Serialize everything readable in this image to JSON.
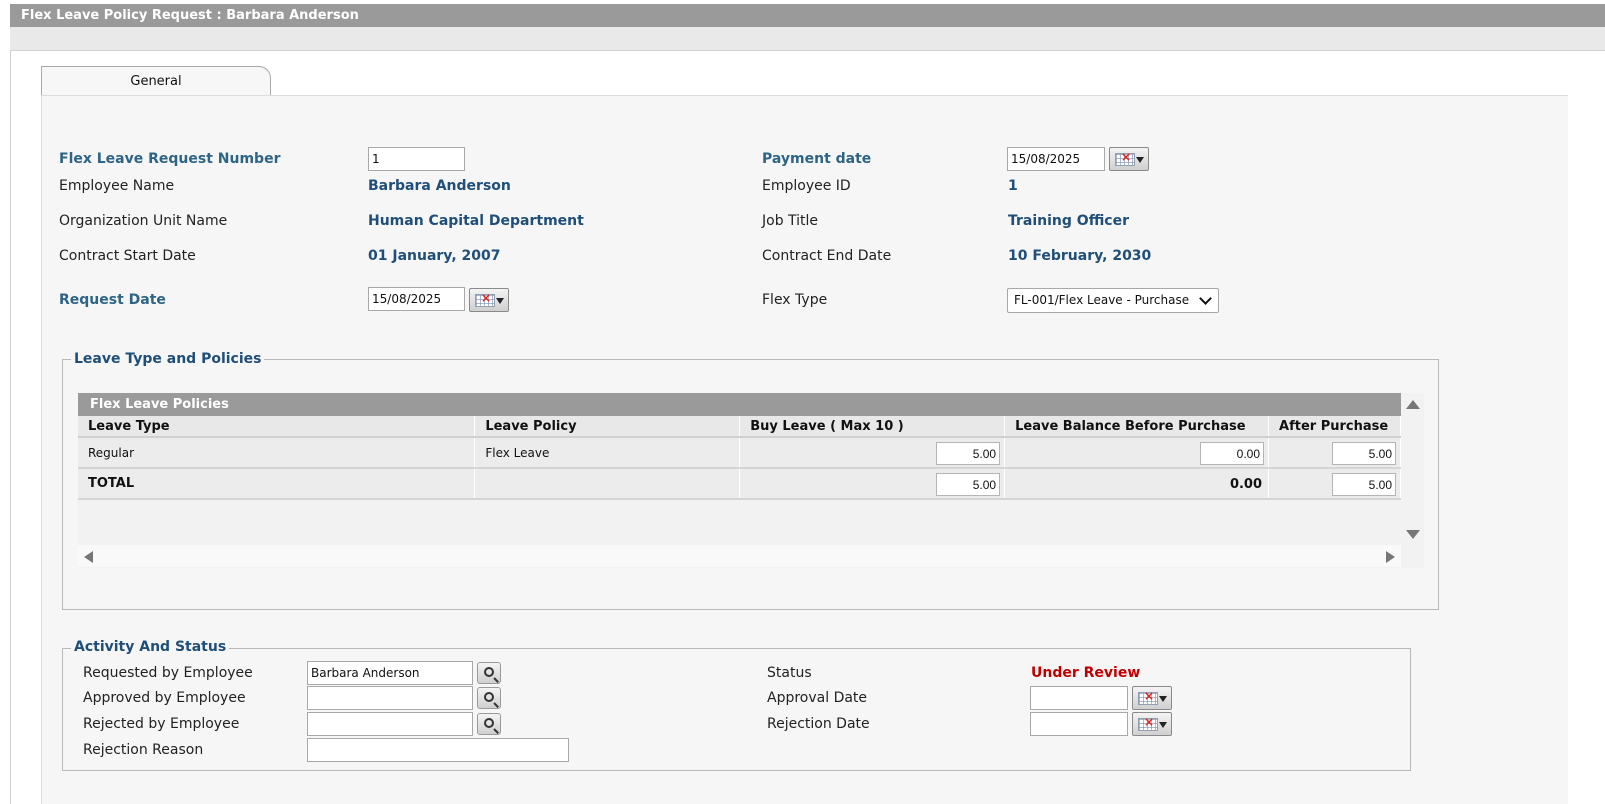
{
  "window": {
    "title": "Flex Leave Policy Request : Barbara Anderson"
  },
  "tabs": [
    {
      "label": "General"
    }
  ],
  "form": {
    "request_number_label": "Flex Leave Request Number",
    "request_number_value": "1",
    "payment_date_label": "Payment date",
    "payment_date_value": "15/08/2025",
    "employee_name_label": "Employee Name",
    "employee_name_value": "Barbara Anderson",
    "employee_id_label": "Employee ID",
    "employee_id_value": "1",
    "org_unit_label": "Organization Unit Name",
    "org_unit_value": "Human Capital Department",
    "job_title_label": "Job Title",
    "job_title_value": "Training Officer",
    "contract_start_label": "Contract Start Date",
    "contract_start_value": "01 January, 2007",
    "contract_end_label": "Contract End Date",
    "contract_end_value": "10 February, 2030",
    "request_date_label": "Request Date",
    "request_date_value": "15/08/2025",
    "flex_type_label": "Flex Type",
    "flex_type_value": "FL-001/Flex Leave - Purchase"
  },
  "policies": {
    "legend": "Leave Type and Policies",
    "grid_title": "Flex Leave Policies",
    "columns": [
      "Leave Type",
      "Leave Policy",
      "Buy Leave ( Max 10 )",
      "Leave Balance Before Purchase",
      "After Purchase"
    ],
    "rows": [
      {
        "leave_type": "Regular",
        "leave_policy": "Flex Leave",
        "buy": "5.00",
        "before": "0.00",
        "after": "5.00"
      }
    ],
    "total": {
      "label": "TOTAL",
      "buy": "5.00",
      "before": "0.00",
      "after": "5.00"
    }
  },
  "activity": {
    "legend": "Activity And Status",
    "requested_by_label": "Requested by Employee",
    "requested_by_value": "Barbara Anderson",
    "approved_by_label": "Approved by Employee",
    "approved_by_value": "",
    "rejected_by_label": "Rejected by Employee",
    "rejected_by_value": "",
    "rejection_reason_label": "Rejection Reason",
    "rejection_reason_value": "",
    "status_label": "Status",
    "status_value": "Under Review",
    "approval_date_label": "Approval Date",
    "approval_date_value": "",
    "rejection_date_label": "Rejection Date",
    "rejection_date_value": ""
  },
  "colors": {
    "title_bar": "#9a9a9a",
    "label_blue": "#2e6486",
    "value_blue": "#1f4e79",
    "status_red": "#c00000"
  },
  "icons": [
    "calendar-icon",
    "dropdown-arrow-icon",
    "search-icon",
    "scroll-left-icon",
    "scroll-right-icon",
    "scroll-up-icon",
    "scroll-down-icon",
    "chevron-down-icon"
  ]
}
